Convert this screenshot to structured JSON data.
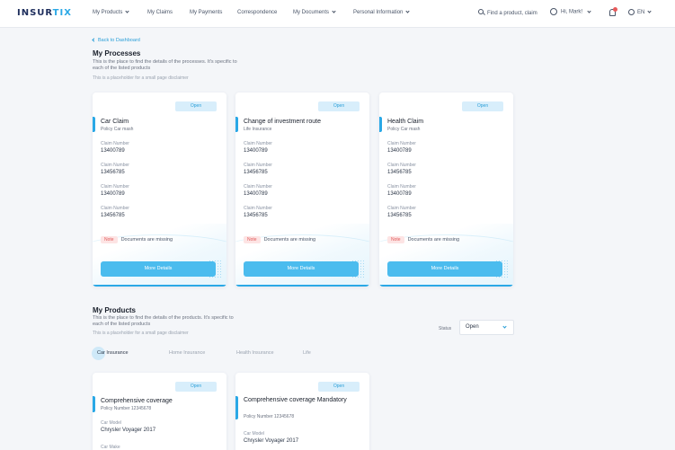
{
  "nav": {
    "logo_part1": "INSUR",
    "logo_part2": "TIX",
    "items": [
      {
        "label": "My Products",
        "has_dropdown": true
      },
      {
        "label": "My Claims",
        "has_dropdown": false
      },
      {
        "label": "My Payments",
        "has_dropdown": false
      },
      {
        "label": "Correspondence",
        "has_dropdown": false
      },
      {
        "label": "My Documents",
        "has_dropdown": true
      },
      {
        "label": "Personal Information",
        "has_dropdown": true
      }
    ],
    "search_label": "Find a product, claim",
    "user_label": "Hi, Mark!",
    "language": "EN",
    "icons": {
      "search": "search-icon",
      "user": "user-icon",
      "notifications": "bell-icon",
      "language": "globe-icon"
    },
    "notification_badge_color": "#e85a5a"
  },
  "back_link": "Back to Dashboard",
  "processes": {
    "title": "My Processes",
    "description": "This is the place to find the details of the processes. It's specific to each of the listed products",
    "note": "This is a placeholder for a small page disclaimer",
    "cards": [
      {
        "badge": "Open",
        "title": "Car Claim",
        "subtitle": "Policy Car mash",
        "fields": [
          {
            "label": "Claim Number",
            "value": "13400789"
          },
          {
            "label": "Claim Number",
            "value": "13456785"
          },
          {
            "label": "Claim Number",
            "value": "13400789"
          },
          {
            "label": "Claim Number",
            "value": "13456785"
          }
        ],
        "note_tag": "Note",
        "note_text": "Documents are missing",
        "button": "More Details"
      },
      {
        "badge": "Open",
        "title": "Change of investment route",
        "subtitle": "Life Insurance",
        "fields": [
          {
            "label": "Claim Number",
            "value": "13400789"
          },
          {
            "label": "Claim Number",
            "value": "13456785"
          },
          {
            "label": "Claim Number",
            "value": "13400789"
          },
          {
            "label": "Claim Number",
            "value": "13456785"
          }
        ],
        "note_tag": "Note",
        "note_text": "Documents are missing",
        "button": "More Details"
      },
      {
        "badge": "Open",
        "title": "Health Claim",
        "subtitle": "Policy Car mash",
        "fields": [
          {
            "label": "Claim Number",
            "value": "13400789"
          },
          {
            "label": "Claim Number",
            "value": "13456785"
          },
          {
            "label": "Claim Number",
            "value": "13400789"
          },
          {
            "label": "Claim Number",
            "value": "13456785"
          }
        ],
        "note_tag": "Note",
        "note_text": "Documents are missing",
        "button": "More Details"
      }
    ]
  },
  "products": {
    "title": "My Products",
    "description": "This is the place to find the details of the products. It's specific to each of the listed products",
    "note": "This is a placeholder for a small page disclaimer",
    "filter_label": "Status",
    "filter_value": "Open",
    "tabs": [
      "Car Insurance",
      "Home Insurance",
      "Health Insurance",
      "Life"
    ],
    "active_tab": 0,
    "cards": [
      {
        "badge": "Open",
        "title": "Comprehensive coverage",
        "subtitle": "Policy Number 12345678",
        "fields": [
          {
            "label": "Car Model",
            "value": "Chrysler Voyager 2017"
          },
          {
            "label": "Car Make",
            "value": ""
          }
        ]
      },
      {
        "badge": "Open",
        "title": "Comprehensive coverage Mandatory",
        "subtitle": "Policy Number 12345678",
        "fields": [
          {
            "label": "Car Model",
            "value": "Chrysler Voyager 2017"
          }
        ]
      }
    ]
  },
  "colors": {
    "accent": "#2aa8e6",
    "button": "#4bbcee",
    "badge_bg": "#d8eefb",
    "note_tag_bg": "#fde4e4",
    "note_tag_text": "#e05a5a",
    "brand_dark": "#1d2d5c"
  }
}
